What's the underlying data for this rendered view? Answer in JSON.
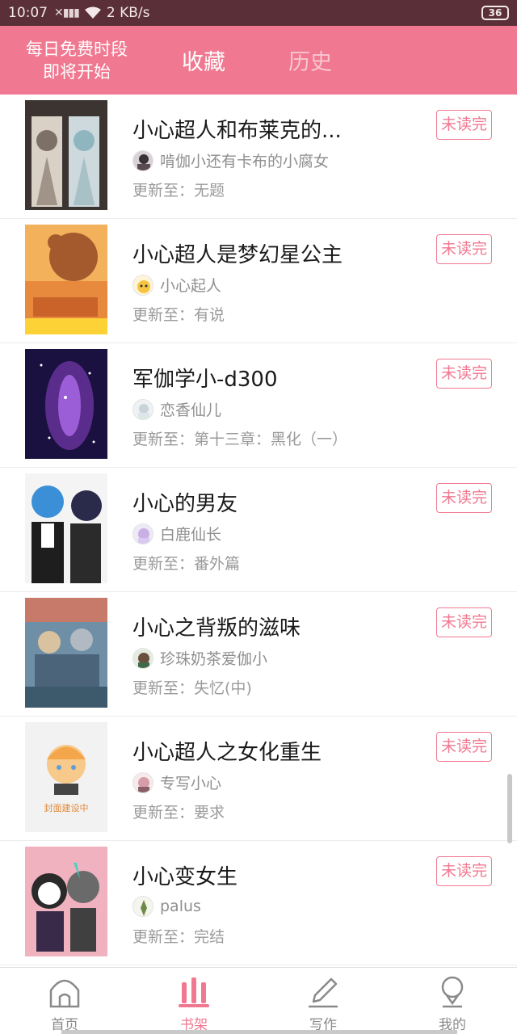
{
  "status_bar": {
    "time": "10:07",
    "net_speed": "2 KB/s",
    "battery": "36"
  },
  "header": {
    "promo_line1": "每日免费时段",
    "promo_line2": "即将开始",
    "tabs": [
      {
        "label": "收藏",
        "active": true
      },
      {
        "label": "历史",
        "active": false
      }
    ]
  },
  "colors": {
    "accent": "#f07890",
    "status_bar": "#5a2f37",
    "inactive_tab": "#f8c6d0"
  },
  "list": {
    "items": [
      {
        "title": "小心超人和布莱克的...",
        "author": "啃伽小还有卡布的小腐女",
        "update": "更新至：无题",
        "badge": "未读完"
      },
      {
        "title": "小心超人是梦幻星公主",
        "author": "小心起人",
        "update": "更新至：有说",
        "badge": "未读完"
      },
      {
        "title": "军伽学小-d300",
        "author": "恋香仙儿",
        "update": "更新至：第十三章：黑化（一）",
        "badge": "未读完"
      },
      {
        "title": "小心的男友",
        "author": "白鹿仙长",
        "update": "更新至：番外篇",
        "badge": "未读完"
      },
      {
        "title": "小心之背叛的滋味",
        "author": "珍珠奶茶爱伽小",
        "update": "更新至：失忆(中)",
        "badge": "未读完"
      },
      {
        "title": "小心超人之女化重生",
        "author": "专写小心",
        "update": "更新至：要求",
        "badge": "未读完",
        "cover_text": "封面建设中"
      },
      {
        "title": "小心变女生",
        "author": "palus",
        "update": "更新至：完结",
        "badge": "未读完"
      }
    ]
  },
  "bottom_nav": [
    {
      "label": "首页",
      "icon": "home-icon",
      "active": false
    },
    {
      "label": "书架",
      "icon": "bookshelf-icon",
      "active": true
    },
    {
      "label": "写作",
      "icon": "pen-icon",
      "active": false
    },
    {
      "label": "我的",
      "icon": "profile-icon",
      "active": false
    }
  ]
}
